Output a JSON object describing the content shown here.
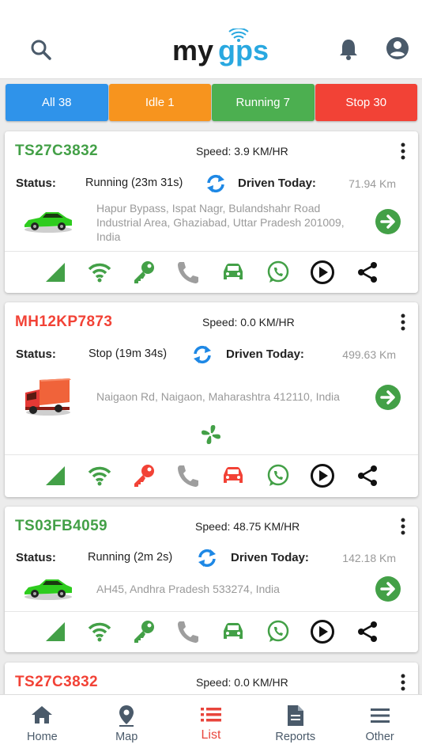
{
  "header": {
    "logo_text_my": "my",
    "logo_text_gps": "gps",
    "icons": [
      "search-icon",
      "bell-icon",
      "account-icon"
    ]
  },
  "tabs": [
    {
      "label": "All 38",
      "color": "#2f93ea"
    },
    {
      "label": "Idle 1",
      "color": "#f7941e"
    },
    {
      "label": "Running 7",
      "color": "#4caf50"
    },
    {
      "label": "Stop 30",
      "color": "#f24236"
    }
  ],
  "vehicles": [
    {
      "plate": "TS27C3832",
      "speed": "Speed: 3.9 KM/HR",
      "status_label": "Status:",
      "status": "Running (23m 31s)",
      "driven_label": "Driven Today:",
      "driven": "71.94 Km",
      "address": "Hapur Bypass, Ispat Nagr, Bulandshahr Road Industrial Area, Ghaziabad, Uttar Pradesh 201009, India",
      "vehicle_type": "car",
      "state_color": "#43a047"
    },
    {
      "plate": "MH12KP7873",
      "speed": "Speed: 0.0 KM/HR",
      "status_label": "Status:",
      "status": "Stop (19m 34s)",
      "driven_label": "Driven Today:",
      "driven": "499.63 Km",
      "address": "Naigaon Rd, Naigaon, Maharashtra 412110, India",
      "vehicle_type": "truck",
      "state_color": "#f24236"
    },
    {
      "plate": "TS03FB4059",
      "speed": "Speed: 48.75 KM/HR",
      "status_label": "Status:",
      "status": "Running (2m 2s)",
      "driven_label": "Driven Today:",
      "driven": "142.18 Km",
      "address": "AH45, Andhra Pradesh 533274, India",
      "vehicle_type": "car",
      "state_color": "#43a047"
    },
    {
      "plate": "TS27C3832",
      "speed": "Speed: 0.0 KM/HR",
      "state_color": "#f24236"
    }
  ],
  "bottom_nav": [
    {
      "label": "Home",
      "icon": "home-icon"
    },
    {
      "label": "Map",
      "icon": "map-pin-icon"
    },
    {
      "label": "List",
      "icon": "list-icon",
      "active": true
    },
    {
      "label": "Reports",
      "icon": "reports-icon"
    },
    {
      "label": "Other",
      "icon": "menu-icon"
    }
  ]
}
